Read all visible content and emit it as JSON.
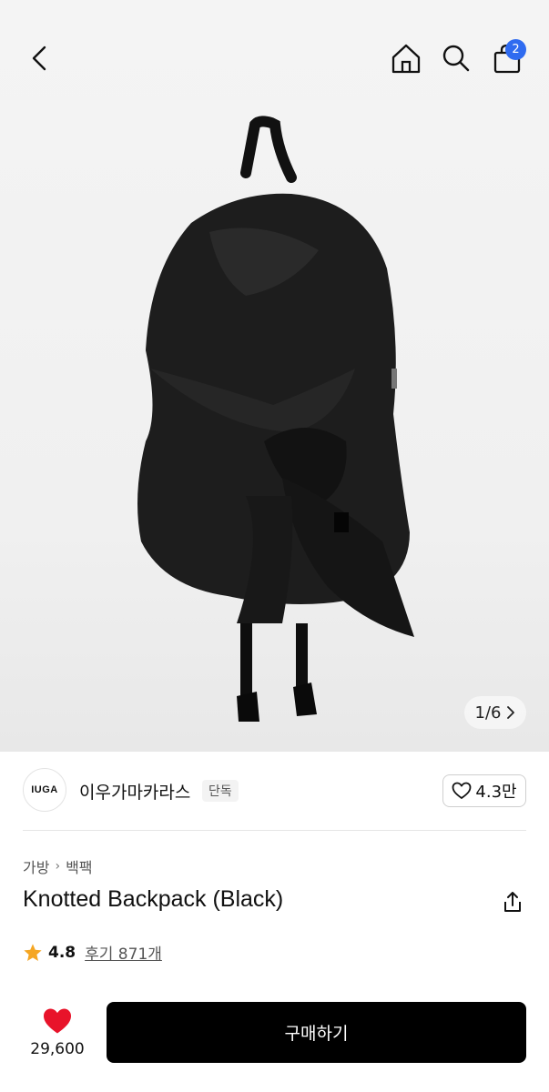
{
  "header": {
    "back_icon": "chevron-left-icon",
    "home_icon": "home-icon",
    "search_icon": "search-icon",
    "cart_icon": "shopping-bag-icon",
    "cart_count": "2",
    "badge_color": "#2f6bf0"
  },
  "gallery": {
    "pager": "1/6",
    "pager_icon": "chevron-right-icon"
  },
  "brand": {
    "logo_text": "IUGA",
    "name": "이우가마카라스",
    "tag": "단독",
    "like_count": "4.3만",
    "like_icon": "heart-outline-icon"
  },
  "product": {
    "breadcrumb": [
      "가방",
      "백팩"
    ],
    "title": "Knotted Backpack (Black)",
    "share_icon": "share-icon",
    "rating": "4.8",
    "reviews": "후기 871개",
    "star_color": "#f5a623"
  },
  "bottom_bar": {
    "like_icon": "heart-filled-icon",
    "like_color": "#e8132a",
    "like_count": "29,600",
    "buy_label": "구매하기"
  }
}
